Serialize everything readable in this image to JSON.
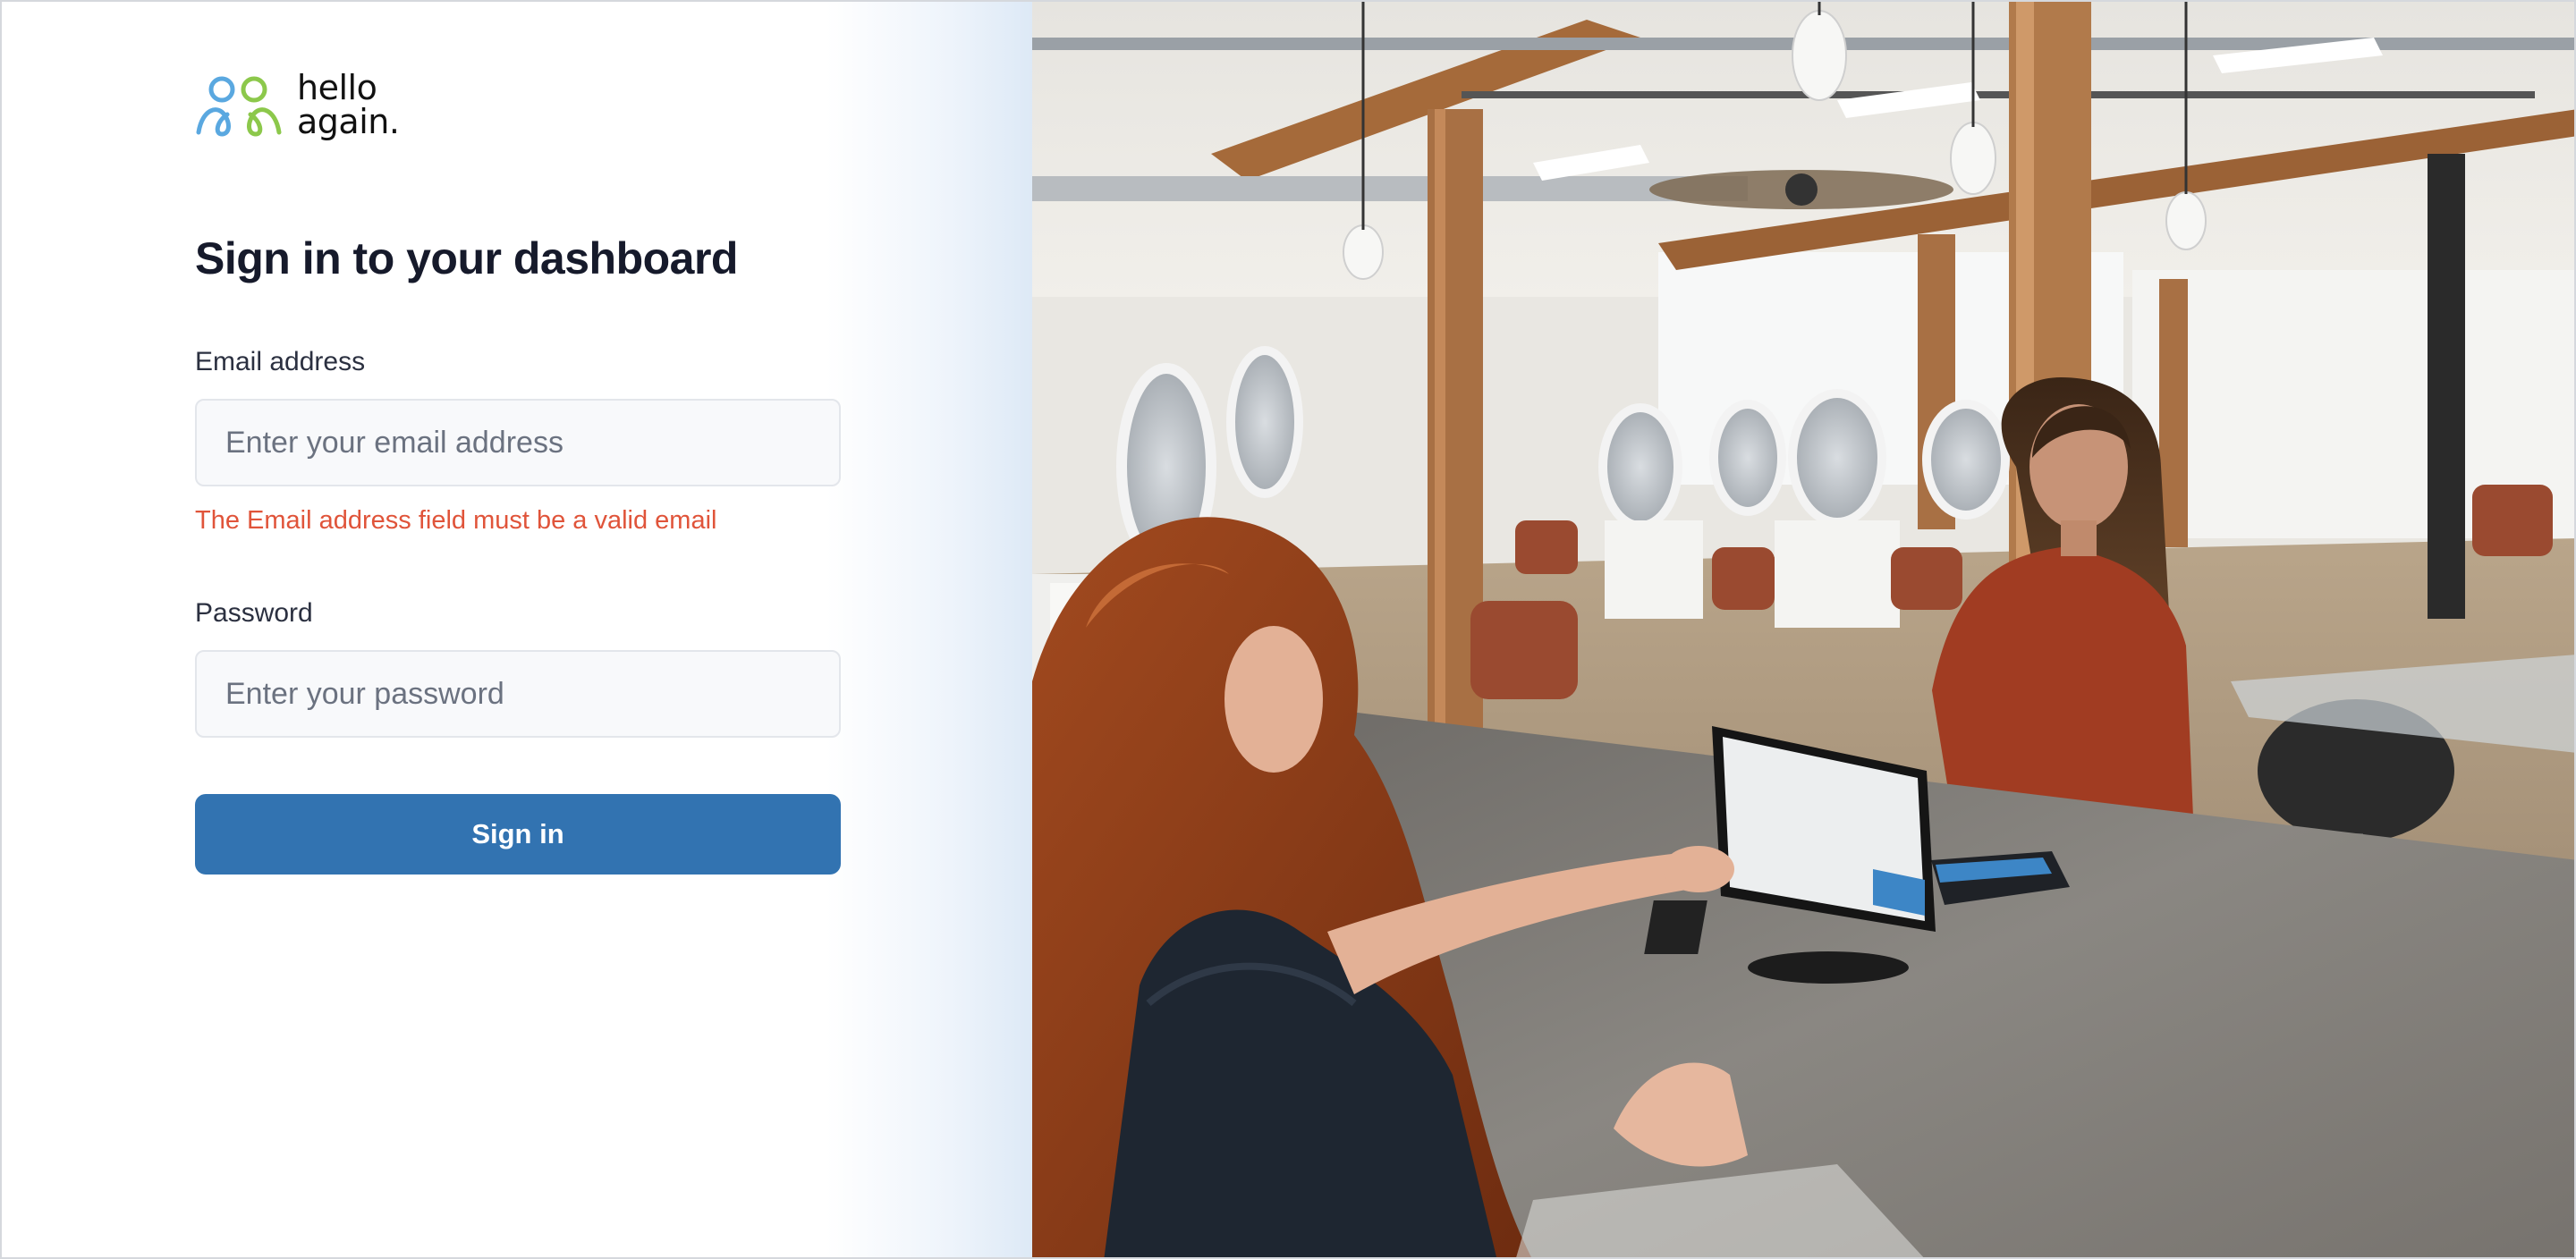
{
  "brand": {
    "logo_line1": "hello",
    "logo_line2": "again.",
    "logo_icon": "two-people-logo-icon",
    "colors": {
      "blue": "#5aa8e0",
      "green": "#8cc84b"
    }
  },
  "form": {
    "title": "Sign in to your dashboard",
    "email_label": "Email address",
    "email_placeholder": "Enter your email address",
    "email_value": "",
    "email_error": "The Email address field must be a valid email",
    "password_label": "Password",
    "password_placeholder": "Enter your password",
    "password_value": "",
    "submit_label": "Sign in"
  },
  "hero": {
    "image_subject": "salon-checkout-photo"
  },
  "colors": {
    "primary_button": "#3273b1",
    "error": "#e0543a",
    "heading": "#161a2b"
  }
}
